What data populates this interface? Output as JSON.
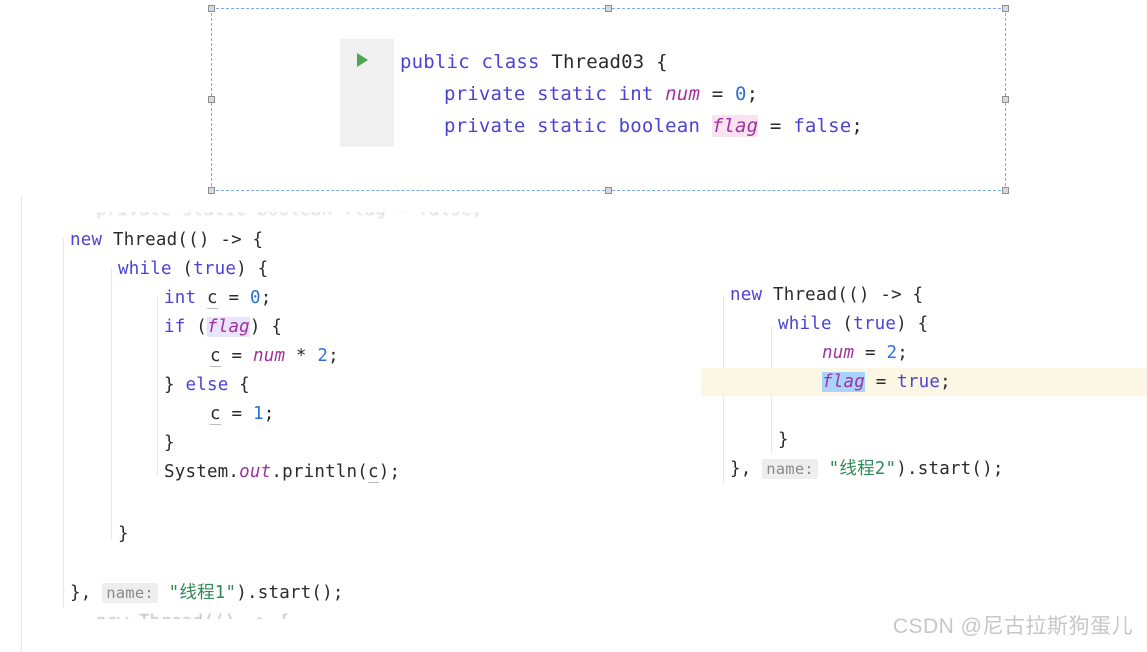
{
  "floating_snippet": {
    "run_icon": "play-triangle-icon",
    "lines": [
      {
        "id": "class-decl",
        "tokens": [
          {
            "t": "public",
            "c": "kw"
          },
          {
            "t": " ",
            "c": "plain"
          },
          {
            "t": "class",
            "c": "kw"
          },
          {
            "t": " ",
            "c": "plain"
          },
          {
            "t": "Thread03",
            "c": "plain"
          },
          {
            "t": " {",
            "c": "punct"
          }
        ]
      },
      {
        "id": "field-num",
        "indent": 44,
        "tokens": [
          {
            "t": "private",
            "c": "kw"
          },
          {
            "t": " ",
            "c": "plain"
          },
          {
            "t": "static",
            "c": "kw"
          },
          {
            "t": " ",
            "c": "plain"
          },
          {
            "t": "int",
            "c": "kw"
          },
          {
            "t": " ",
            "c": "plain"
          },
          {
            "t": "num",
            "c": "field"
          },
          {
            "t": " = ",
            "c": "punct"
          },
          {
            "t": "0",
            "c": "num"
          },
          {
            "t": ";",
            "c": "punct"
          }
        ]
      },
      {
        "id": "field-flag",
        "indent": 44,
        "tokens": [
          {
            "t": "private",
            "c": "kw"
          },
          {
            "t": " ",
            "c": "plain"
          },
          {
            "t": "static",
            "c": "kw"
          },
          {
            "t": " ",
            "c": "plain"
          },
          {
            "t": "boolean",
            "c": "kw"
          },
          {
            "t": " ",
            "c": "plain"
          },
          {
            "t": "flag",
            "c": "field hl-pink"
          },
          {
            "t": " = ",
            "c": "punct"
          },
          {
            "t": "false",
            "c": "kw"
          },
          {
            "t": ";",
            "c": "punct"
          }
        ]
      }
    ]
  },
  "left_code": {
    "clipped_top_text": "private static boolean flag = false;",
    "clipped_bottom_text": "new Thread(() -> {",
    "lines": [
      {
        "id": "new-thread",
        "indent": 70,
        "tokens": [
          {
            "t": "new",
            "c": "kw"
          },
          {
            "t": " ",
            "c": "plain"
          },
          {
            "t": "Thread",
            "c": "plain"
          },
          {
            "t": "(() -> {",
            "c": "punct"
          }
        ]
      },
      {
        "id": "while-true",
        "indent": 118,
        "tokens": [
          {
            "t": "while",
            "c": "kw"
          },
          {
            "t": " (",
            "c": "punct"
          },
          {
            "t": "true",
            "c": "kw"
          },
          {
            "t": ") {",
            "c": "punct"
          }
        ]
      },
      {
        "id": "int-c",
        "indent": 164,
        "tokens": [
          {
            "t": "int",
            "c": "kw"
          },
          {
            "t": " ",
            "c": "plain"
          },
          {
            "t": "c",
            "c": "localv"
          },
          {
            "t": " = ",
            "c": "punct"
          },
          {
            "t": "0",
            "c": "num"
          },
          {
            "t": ";",
            "c": "punct"
          }
        ]
      },
      {
        "id": "if-flag",
        "indent": 164,
        "tokens": [
          {
            "t": "if",
            "c": "kw"
          },
          {
            "t": " (",
            "c": "punct"
          },
          {
            "t": "flag",
            "c": "field hl-lavender"
          },
          {
            "t": ") {",
            "c": "punct"
          }
        ]
      },
      {
        "id": "c-num-times-2",
        "indent": 210,
        "tokens": [
          {
            "t": "c",
            "c": "localv"
          },
          {
            "t": " = ",
            "c": "punct"
          },
          {
            "t": "num",
            "c": "field"
          },
          {
            "t": " * ",
            "c": "punct"
          },
          {
            "t": "2",
            "c": "num"
          },
          {
            "t": ";",
            "c": "punct"
          }
        ]
      },
      {
        "id": "else-brace",
        "indent": 164,
        "tokens": [
          {
            "t": "} ",
            "c": "punct"
          },
          {
            "t": "else",
            "c": "kw"
          },
          {
            "t": " {",
            "c": "punct"
          }
        ]
      },
      {
        "id": "c-equals-1",
        "indent": 210,
        "tokens": [
          {
            "t": "c",
            "c": "localv"
          },
          {
            "t": " = ",
            "c": "punct"
          },
          {
            "t": "1",
            "c": "num"
          },
          {
            "t": ";",
            "c": "punct"
          }
        ]
      },
      {
        "id": "close-if",
        "indent": 164,
        "tokens": [
          {
            "t": "}",
            "c": "punct"
          }
        ]
      },
      {
        "id": "println",
        "indent": 164,
        "tokens": [
          {
            "t": "System",
            "c": "plain"
          },
          {
            "t": ".",
            "c": "punct"
          },
          {
            "t": "out",
            "c": "staticm"
          },
          {
            "t": ".println(",
            "c": "punct"
          },
          {
            "t": "c",
            "c": "localv"
          },
          {
            "t": ");",
            "c": "punct"
          }
        ]
      },
      {
        "id": "close-while",
        "indent": 118,
        "tokens": [
          {
            "t": "}",
            "c": "punct"
          }
        ]
      },
      {
        "id": "thread-start",
        "indent": 70,
        "tokens": [
          {
            "t": "}, ",
            "c": "punct"
          },
          {
            "t": "name:",
            "c": "hint"
          },
          {
            "t": " ",
            "c": "plain"
          },
          {
            "t": "\"线程1\"",
            "c": "str"
          },
          {
            "t": ").start();",
            "c": "punct"
          }
        ]
      }
    ]
  },
  "right_code": {
    "lines": [
      {
        "id": "new-thread",
        "indent": 730,
        "tokens": [
          {
            "t": "new",
            "c": "kw"
          },
          {
            "t": " ",
            "c": "plain"
          },
          {
            "t": "Thread",
            "c": "plain"
          },
          {
            "t": "(() -> {",
            "c": "punct"
          }
        ]
      },
      {
        "id": "while-true",
        "indent": 778,
        "tokens": [
          {
            "t": "while",
            "c": "kw"
          },
          {
            "t": " (",
            "c": "punct"
          },
          {
            "t": "true",
            "c": "kw"
          },
          {
            "t": ") {",
            "c": "punct"
          }
        ]
      },
      {
        "id": "num-equals-2",
        "indent": 822,
        "tokens": [
          {
            "t": "num",
            "c": "field"
          },
          {
            "t": " = ",
            "c": "punct"
          },
          {
            "t": "2",
            "c": "num"
          },
          {
            "t": ";",
            "c": "punct"
          }
        ]
      },
      {
        "id": "flag-equals-true",
        "indent": 822,
        "tokens": [
          {
            "t": "flag",
            "c": "field hl-blue-sel"
          },
          {
            "t": " = ",
            "c": "punct"
          },
          {
            "t": "true",
            "c": "kw"
          },
          {
            "t": ";",
            "c": "punct"
          }
        ]
      },
      {
        "id": "close-while",
        "indent": 778,
        "tokens": [
          {
            "t": "}",
            "c": "punct"
          }
        ]
      },
      {
        "id": "thread-start",
        "indent": 730,
        "tokens": [
          {
            "t": "}, ",
            "c": "punct"
          },
          {
            "t": "name:",
            "c": "hint"
          },
          {
            "t": " ",
            "c": "plain"
          },
          {
            "t": "\"线程2\"",
            "c": "str"
          },
          {
            "t": ").start();",
            "c": "punct"
          }
        ]
      }
    ]
  },
  "watermark": {
    "text": "CSDN @尼古拉斯狗蛋儿"
  },
  "colors": {
    "keyword": "#4b43d6",
    "field": "#a0329e",
    "number": "#2f6fd8",
    "string": "#2e8b57",
    "plain": "#2b2b2b",
    "selection_border": "#7aa9f0",
    "gutter_bg": "#f0f0f0",
    "run_triangle": "#4aa651",
    "highlight_pink": "#fbe2f1",
    "highlight_lavender": "#eae4fb",
    "highlight_blue": "#a8d4fb",
    "caret_row": "#fbf7e4",
    "watermark": "#c7c7c7"
  }
}
